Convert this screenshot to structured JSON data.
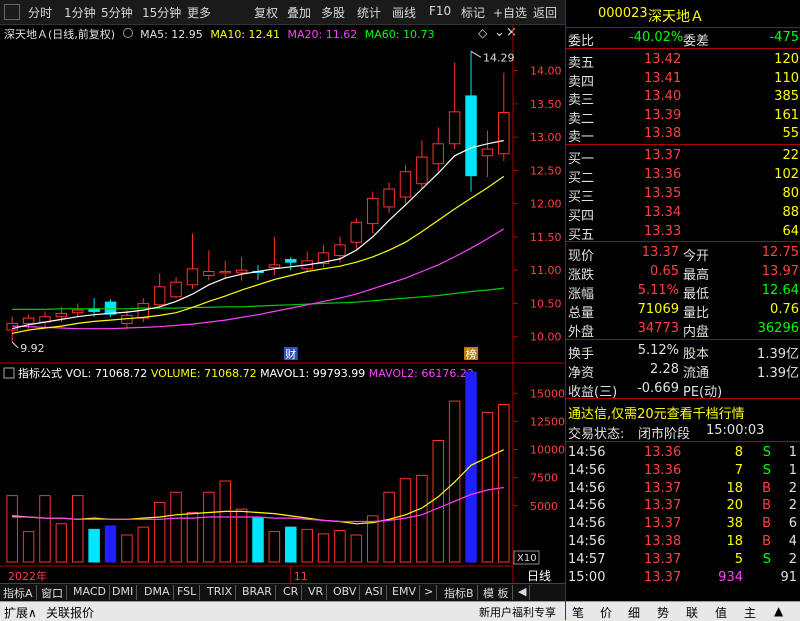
{
  "toolbar": {
    "items": [
      "分时",
      "1分钟",
      "5分钟",
      "15分钟",
      "更多",
      "复权",
      "叠加",
      "多股",
      "统计",
      "画线",
      "F10",
      "标记",
      "+自选",
      "返回"
    ]
  },
  "chart_header": {
    "stock_label": "深天地Ａ(日线,前复权)",
    "ma5": "MA5: 12.95",
    "ma10": "MA10: 12.41",
    "ma20": "MA20: 11.62",
    "ma60": "MA60: 10.73"
  },
  "colors": {
    "ma5": "#ffffff",
    "ma10": "#ffff00",
    "ma20": "#ff40ff",
    "ma60": "#00cc00",
    "up": "#ff3030",
    "down": "#00e5ff",
    "axis": "#b00000"
  },
  "chart_data": [
    {
      "type": "candlestick",
      "ylim": [
        9.8,
        14.4
      ],
      "yticks": [
        "14.00",
        "13.50",
        "13.00",
        "12.50",
        "12.00",
        "11.50",
        "11.00",
        "10.50",
        "10.00"
      ],
      "ytick_values": [
        14.0,
        13.5,
        13.0,
        12.5,
        12.0,
        11.5,
        11.0,
        10.5,
        10.0
      ],
      "high_label": "14.29",
      "low_label": "9.92",
      "markers": [
        "财",
        "榜"
      ],
      "candles": [
        {
          "o": 10.1,
          "c": 10.2,
          "h": 10.3,
          "l": 9.92
        },
        {
          "o": 10.2,
          "c": 10.28,
          "h": 10.33,
          "l": 10.12
        },
        {
          "o": 10.22,
          "c": 10.3,
          "h": 10.38,
          "l": 10.15
        },
        {
          "o": 10.3,
          "c": 10.35,
          "h": 10.45,
          "l": 10.22
        },
        {
          "o": 10.36,
          "c": 10.4,
          "h": 10.5,
          "l": 10.3
        },
        {
          "o": 10.42,
          "c": 10.38,
          "h": 10.58,
          "l": 10.3
        },
        {
          "o": 10.52,
          "c": 10.34,
          "h": 10.56,
          "l": 10.3
        },
        {
          "o": 10.2,
          "c": 10.32,
          "h": 10.4,
          "l": 10.12
        },
        {
          "o": 10.28,
          "c": 10.5,
          "h": 10.58,
          "l": 10.22
        },
        {
          "o": 10.48,
          "c": 10.75,
          "h": 10.95,
          "l": 10.42
        },
        {
          "o": 10.6,
          "c": 10.82,
          "h": 10.9,
          "l": 10.58
        },
        {
          "o": 10.78,
          "c": 11.02,
          "h": 11.55,
          "l": 10.72
        },
        {
          "o": 10.92,
          "c": 10.98,
          "h": 11.3,
          "l": 10.85
        },
        {
          "o": 10.96,
          "c": 10.98,
          "h": 11.14,
          "l": 10.88
        },
        {
          "o": 10.96,
          "c": 11.0,
          "h": 11.2,
          "l": 10.84
        },
        {
          "o": 10.98,
          "c": 10.97,
          "h": 11.08,
          "l": 10.85
        },
        {
          "o": 11.04,
          "c": 11.08,
          "h": 11.5,
          "l": 10.92
        },
        {
          "o": 11.16,
          "c": 11.12,
          "h": 11.2,
          "l": 11.0
        },
        {
          "o": 11.02,
          "c": 11.14,
          "h": 11.28,
          "l": 10.98
        },
        {
          "o": 11.1,
          "c": 11.26,
          "h": 11.38,
          "l": 11.05
        },
        {
          "o": 11.22,
          "c": 11.38,
          "h": 11.5,
          "l": 11.12
        },
        {
          "o": 11.42,
          "c": 11.72,
          "h": 11.78,
          "l": 11.32
        },
        {
          "o": 11.7,
          "c": 12.08,
          "h": 12.18,
          "l": 11.55
        },
        {
          "o": 11.95,
          "c": 12.22,
          "h": 12.32,
          "l": 11.86
        },
        {
          "o": 12.1,
          "c": 12.48,
          "h": 12.58,
          "l": 12.0
        },
        {
          "o": 12.3,
          "c": 12.7,
          "h": 12.95,
          "l": 12.22
        },
        {
          "o": 12.6,
          "c": 12.9,
          "h": 13.15,
          "l": 12.45
        },
        {
          "o": 12.9,
          "c": 13.38,
          "h": 14.12,
          "l": 12.82
        },
        {
          "o": 13.62,
          "c": 12.42,
          "h": 14.29,
          "l": 12.18
        },
        {
          "o": 12.72,
          "c": 12.82,
          "h": 13.1,
          "l": 12.4
        },
        {
          "o": 12.75,
          "c": 13.37,
          "h": 13.97,
          "l": 12.64
        }
      ],
      "ma5": [
        10.12,
        10.18,
        10.22,
        10.26,
        10.3,
        10.33,
        10.35,
        10.37,
        10.4,
        10.45,
        10.53,
        10.64,
        10.78,
        10.88,
        10.94,
        10.98,
        11.02,
        11.05,
        11.08,
        11.12,
        11.17,
        11.3,
        11.5,
        11.75,
        11.98,
        12.22,
        12.46,
        12.72,
        12.84,
        12.9,
        12.95
      ],
      "ma10": [
        10.05,
        10.1,
        10.13,
        10.16,
        10.2,
        10.23,
        10.25,
        10.27,
        10.29,
        10.32,
        10.36,
        10.44,
        10.53,
        10.61,
        10.7,
        10.78,
        10.86,
        10.92,
        10.98,
        11.02,
        11.06,
        11.12,
        11.2,
        11.3,
        11.42,
        11.58,
        11.75,
        11.92,
        12.08,
        12.24,
        12.41
      ],
      "ma20": [
        10.16,
        10.15,
        10.14,
        10.13,
        10.12,
        10.12,
        10.12,
        10.13,
        10.14,
        10.15,
        10.17,
        10.19,
        10.22,
        10.25,
        10.29,
        10.33,
        10.38,
        10.43,
        10.48,
        10.53,
        10.58,
        10.64,
        10.72,
        10.8,
        10.88,
        10.98,
        11.08,
        11.2,
        11.33,
        11.47,
        11.62
      ],
      "ma60": [
        10.41,
        10.41,
        10.41,
        10.42,
        10.42,
        10.42,
        10.42,
        10.42,
        10.43,
        10.43,
        10.43,
        10.44,
        10.44,
        10.45,
        10.45,
        10.46,
        10.47,
        10.48,
        10.49,
        10.5,
        10.51,
        10.52,
        10.54,
        10.56,
        10.58,
        10.6,
        10.62,
        10.65,
        10.68,
        10.7,
        10.73
      ]
    },
    {
      "type": "bar",
      "title": "指标公式",
      "legend": [
        "VOL: 71068.72",
        "VOLUME: 71068.72",
        "MAVOL1: 99793.99",
        "MAVOL2: 66176.22"
      ],
      "ylim": [
        0,
        16000
      ],
      "yticks": [
        "15000",
        "12500",
        "10000",
        "7500",
        "5000"
      ],
      "ytick_values": [
        15000,
        12500,
        10000,
        7500,
        5000
      ],
      "scale_label": "X10",
      "x_labels": [
        "2022年",
        "11"
      ],
      "values": [
        5900,
        2700,
        5900,
        3400,
        5900,
        2900,
        3200,
        2400,
        3100,
        5300,
        6200,
        4400,
        6200,
        7200,
        4700,
        3900,
        2700,
        3100,
        2900,
        2500,
        2800,
        2400,
        4100,
        6200,
        7400,
        7700,
        10800,
        14300,
        17300,
        13300,
        14000
      ],
      "mavol1": [
        4100,
        4000,
        3900,
        3900,
        3800,
        3900,
        3800,
        3800,
        3900,
        4000,
        4200,
        4300,
        4400,
        4500,
        4500,
        4400,
        4300,
        4100,
        3900,
        3700,
        3600,
        3400,
        3500,
        3800,
        4200,
        4800,
        5800,
        7100,
        8600,
        9300,
        9979
      ],
      "mavol2": [
        4000,
        4000,
        3900,
        3900,
        3800,
        3800,
        3800,
        3800,
        3800,
        3800,
        3900,
        3900,
        4000,
        4000,
        4000,
        4000,
        3900,
        3900,
        3800,
        3700,
        3600,
        3600,
        3600,
        3700,
        3900,
        4200,
        4800,
        5400,
        6000,
        6400,
        6618
      ]
    }
  ],
  "bottom_tabs": [
    "指标A",
    "窗口",
    "MACD",
    "DMI",
    "DMA",
    "FSL",
    "TRIX",
    "BRAR",
    "CR",
    "VR",
    "OBV",
    "ASI",
    "EMV",
    ">",
    "指标B",
    "模 板",
    "◀"
  ],
  "period_label": "日线",
  "status_bar": {
    "left": [
      "扩展∧",
      "关联报价"
    ],
    "promo": "新用户福利专享",
    "tabs": [
      "笔",
      "价",
      "细",
      "势",
      "联",
      "值",
      "主",
      "▲"
    ]
  },
  "quote": {
    "code": "000023",
    "name": "深天地Ａ",
    "webi_label": "委比",
    "webi": "-40.02%",
    "weicha_label": "委差",
    "weicha": "-475",
    "asks": [
      {
        "label": "卖五",
        "price": "13.42",
        "vol": "120"
      },
      {
        "label": "卖四",
        "price": "13.41",
        "vol": "110"
      },
      {
        "label": "卖三",
        "price": "13.40",
        "vol": "385"
      },
      {
        "label": "卖二",
        "price": "13.39",
        "vol": "161"
      },
      {
        "label": "卖一",
        "price": "13.38",
        "vol": "55"
      }
    ],
    "bids": [
      {
        "label": "买一",
        "price": "13.37",
        "vol": "22"
      },
      {
        "label": "买二",
        "price": "13.36",
        "vol": "102"
      },
      {
        "label": "买三",
        "price": "13.35",
        "vol": "80"
      },
      {
        "label": "买四",
        "price": "13.34",
        "vol": "88"
      },
      {
        "label": "买五",
        "price": "13.33",
        "vol": "64"
      }
    ],
    "stats": [
      {
        "l1": "现价",
        "v1": "13.37",
        "l2": "今开",
        "v2": "12.75"
      },
      {
        "l1": "涨跌",
        "v1": "0.65",
        "l2": "最高",
        "v2": "13.97"
      },
      {
        "l1": "涨幅",
        "v1": "5.11%",
        "l2": "最低",
        "v2": "12.64"
      },
      {
        "l1": "总量",
        "v1": "71069",
        "l2": "量比",
        "v2": "0.76"
      },
      {
        "l1": "外盘",
        "v1": "34773",
        "l2": "内盘",
        "v2": "36296"
      }
    ],
    "stats2": [
      {
        "l1": "换手",
        "v1": "5.12%",
        "l2": "股本",
        "v2": "1.39亿"
      },
      {
        "l1": "净资",
        "v1": "2.28",
        "l2": "流通",
        "v2": "1.39亿"
      },
      {
        "l1": "收益(三)",
        "v1": "-0.669",
        "l2": "PE(动)",
        "v2": ""
      }
    ],
    "banner": "通达信,仅需20元查看千档行情",
    "trade_status_label": "交易状态:",
    "trade_status": "闭市阶段",
    "trade_time": "15:00:03",
    "ticks": [
      {
        "t": "14:56",
        "p": "13.36",
        "v": "8",
        "s": "S",
        "n": "1"
      },
      {
        "t": "14:56",
        "p": "13.36",
        "v": "7",
        "s": "S",
        "n": "1"
      },
      {
        "t": "14:56",
        "p": "13.37",
        "v": "18",
        "s": "B",
        "n": "2"
      },
      {
        "t": "14:56",
        "p": "13.37",
        "v": "20",
        "s": "B",
        "n": "2"
      },
      {
        "t": "14:56",
        "p": "13.37",
        "v": "38",
        "s": "B",
        "n": "6"
      },
      {
        "t": "14:56",
        "p": "13.38",
        "v": "18",
        "s": "B",
        "n": "4"
      },
      {
        "t": "14:57",
        "p": "13.37",
        "v": "5",
        "s": "S",
        "n": "2"
      },
      {
        "t": "15:00",
        "p": "13.37",
        "v": "934",
        "s": "",
        "n": "91"
      }
    ]
  }
}
